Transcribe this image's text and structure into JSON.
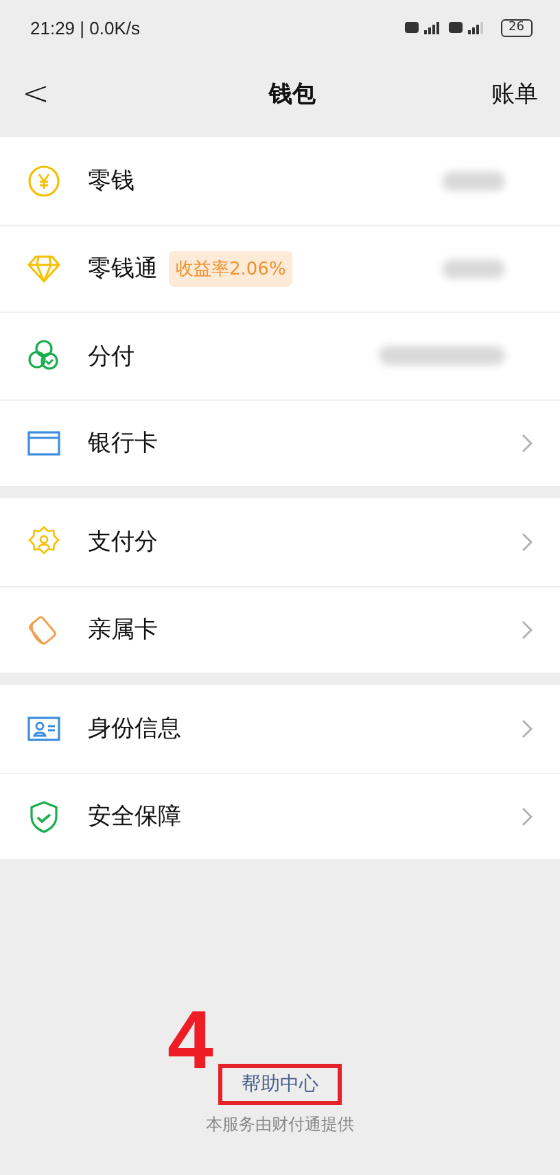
{
  "status_bar": {
    "time_speed": "21:29 | 0.0K/s",
    "battery": "26"
  },
  "header": {
    "back": "<",
    "title": "钱包",
    "action": "账单"
  },
  "groups": [
    {
      "items": [
        {
          "label": "零钱",
          "kind": "hidden_value"
        },
        {
          "label": "零钱通",
          "kind": "hidden_value",
          "badge": "收益率2.06%"
        },
        {
          "label": "分付",
          "kind": "hidden_value"
        },
        {
          "label": "银行卡",
          "kind": "link"
        }
      ]
    },
    {
      "items": [
        {
          "label": "支付分",
          "kind": "link"
        },
        {
          "label": "亲属卡",
          "kind": "link"
        }
      ]
    },
    {
      "items": [
        {
          "label": "身份信息",
          "kind": "link"
        },
        {
          "label": "安全保障",
          "kind": "link"
        }
      ]
    }
  ],
  "footer": {
    "annotation": "4",
    "help_link": "帮助中心",
    "provider_note": "本服务由财付通提供"
  }
}
